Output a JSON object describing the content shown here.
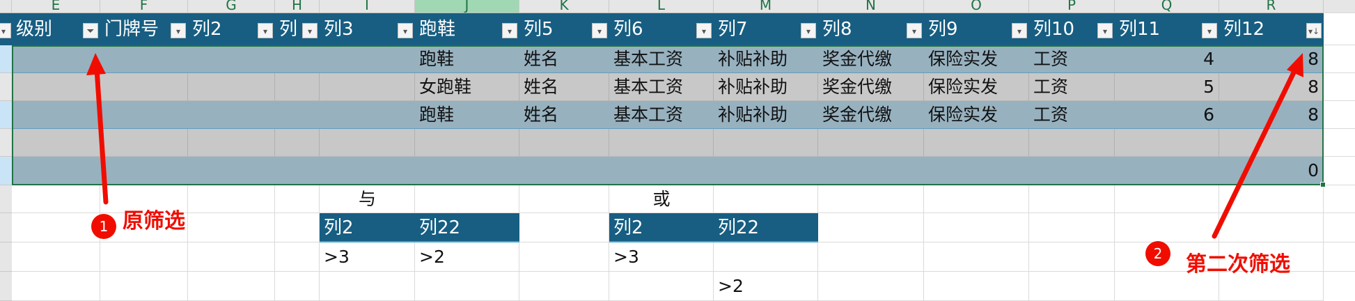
{
  "column_letters": [
    "E",
    "F",
    "G",
    "H",
    "I",
    "J",
    "K",
    "L",
    "M",
    "N",
    "O",
    "P",
    "Q",
    "R"
  ],
  "selected_column": "J",
  "table": {
    "headers": [
      "级别",
      "门牌号",
      "列2",
      "列",
      "列3",
      "跑鞋",
      "列5",
      "列6",
      "列7",
      "列8",
      "列9",
      "列10",
      "列11",
      "列12"
    ],
    "rows": [
      [
        "",
        "",
        "",
        "",
        "",
        "跑鞋",
        "姓名",
        "基本工资",
        "补贴补助",
        "奖金代缴",
        "保险实发",
        "工资",
        "4",
        "8"
      ],
      [
        "",
        "",
        "",
        "",
        "",
        "女跑鞋",
        "姓名",
        "基本工资",
        "补贴补助",
        "奖金代缴",
        "保险实发",
        "工资",
        "5",
        "8"
      ],
      [
        "",
        "",
        "",
        "",
        "",
        "跑鞋",
        "姓名",
        "基本工资",
        "补贴补助",
        "奖金代缴",
        "保险实发",
        "工资",
        "6",
        "8"
      ],
      [
        "",
        "",
        "",
        "",
        "",
        "",
        "",
        "",
        "",
        "",
        "",
        "",
        "",
        ""
      ],
      [
        "",
        "",
        "",
        "",
        "",
        "",
        "",
        "",
        "",
        "",
        "",
        "",
        "",
        "0"
      ]
    ],
    "filter_active_column": "级别",
    "sorted_column": "列12"
  },
  "criteria_and": {
    "label": "与",
    "headers": [
      "列2",
      "列22"
    ],
    "row1": [
      ">3",
      ">2"
    ]
  },
  "criteria_or": {
    "label": "或",
    "headers": [
      "列2",
      "列22"
    ],
    "row1": [
      ">3",
      ""
    ],
    "row2": [
      "",
      ">2"
    ]
  },
  "annotations": [
    {
      "number": "1",
      "text": "原筛选"
    },
    {
      "number": "2",
      "text": "第二次筛选"
    }
  ],
  "colors": {
    "header_bg": "#175e82",
    "band_blue": "#97b1bf",
    "band_gray": "#c8c8c8",
    "annotation": "#f00d00"
  }
}
